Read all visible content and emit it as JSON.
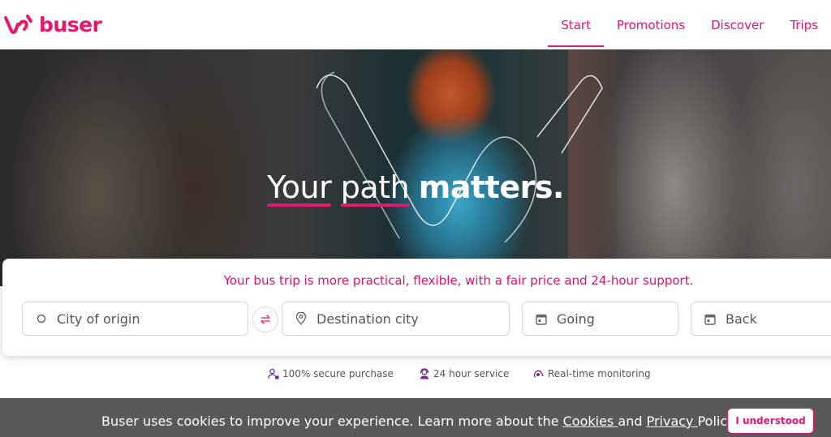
{
  "brand": {
    "name": "buser",
    "accent": "#e3186f"
  },
  "nav": {
    "items": [
      {
        "label": "Start",
        "active": true
      },
      {
        "label": "Promotions",
        "active": false
      },
      {
        "label": "Discover",
        "active": false
      },
      {
        "label": "Trips",
        "active": false
      }
    ]
  },
  "hero": {
    "title_word1": "Your",
    "title_word2": "path",
    "title_word3": "matters."
  },
  "search": {
    "tagline": "Your bus trip is more practical, flexible, with a fair price and 24-hour support.",
    "origin_placeholder": "City of origin",
    "destination_placeholder": "Destination city",
    "going_placeholder": "Going",
    "back_placeholder": "Back"
  },
  "features": [
    {
      "label": "100% secure purchase",
      "icon": "secure-user-icon"
    },
    {
      "label": "24 hour service",
      "icon": "support-agent-icon"
    },
    {
      "label": "Real-time monitoring",
      "icon": "tracking-icon"
    }
  ],
  "cookie": {
    "text_before": "Buser uses cookies to improve your experience. Learn more about the ",
    "cookies_link": "Cookies ",
    "text_and": "and ",
    "privacy_link": "Privacy ",
    "text_after": "Policy .",
    "button_label": "I understood"
  }
}
